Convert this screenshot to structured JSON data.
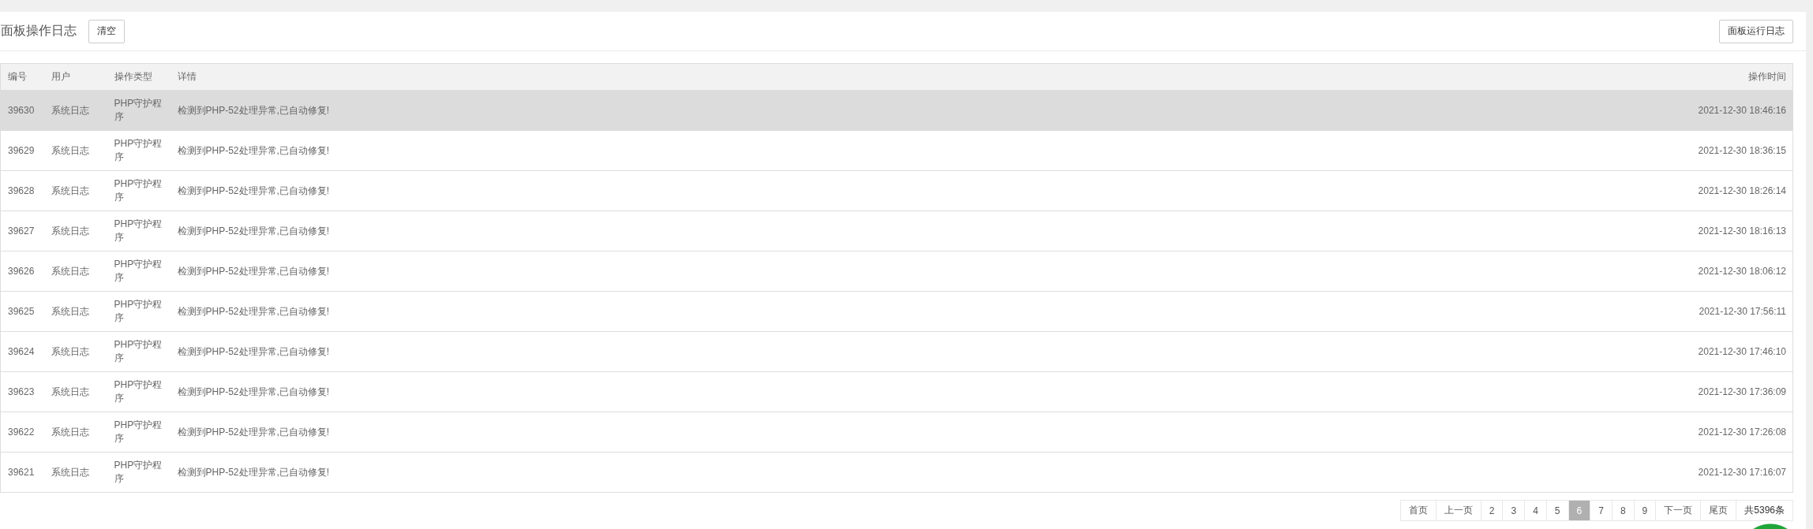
{
  "header": {
    "title": "面板操作日志",
    "clear_button": "清空",
    "run_log_button": "面板运行日志"
  },
  "table": {
    "columns": [
      "编号",
      "用户",
      "操作类型",
      "详情",
      "操作时间"
    ],
    "rows": [
      {
        "id": "39630",
        "user": "系统日志",
        "type": "PHP守护程序",
        "detail": "检测到PHP-52处理异常,已自动修复!",
        "time": "2021-12-30 18:46:16",
        "highlighted": true
      },
      {
        "id": "39629",
        "user": "系统日志",
        "type": "PHP守护程序",
        "detail": "检测到PHP-52处理异常,已自动修复!",
        "time": "2021-12-30 18:36:15",
        "highlighted": false
      },
      {
        "id": "39628",
        "user": "系统日志",
        "type": "PHP守护程序",
        "detail": "检测到PHP-52处理异常,已自动修复!",
        "time": "2021-12-30 18:26:14",
        "highlighted": false
      },
      {
        "id": "39627",
        "user": "系统日志",
        "type": "PHP守护程序",
        "detail": "检测到PHP-52处理异常,已自动修复!",
        "time": "2021-12-30 18:16:13",
        "highlighted": false
      },
      {
        "id": "39626",
        "user": "系统日志",
        "type": "PHP守护程序",
        "detail": "检测到PHP-52处理异常,已自动修复!",
        "time": "2021-12-30 18:06:12",
        "highlighted": false
      },
      {
        "id": "39625",
        "user": "系统日志",
        "type": "PHP守护程序",
        "detail": "检测到PHP-52处理异常,已自动修复!",
        "time": "2021-12-30 17:56:11",
        "highlighted": false
      },
      {
        "id": "39624",
        "user": "系统日志",
        "type": "PHP守护程序",
        "detail": "检测到PHP-52处理异常,已自动修复!",
        "time": "2021-12-30 17:46:10",
        "highlighted": false
      },
      {
        "id": "39623",
        "user": "系统日志",
        "type": "PHP守护程序",
        "detail": "检测到PHP-52处理异常,已自动修复!",
        "time": "2021-12-30 17:36:09",
        "highlighted": false
      },
      {
        "id": "39622",
        "user": "系统日志",
        "type": "PHP守护程序",
        "detail": "检测到PHP-52处理异常,已自动修复!",
        "time": "2021-12-30 17:26:08",
        "highlighted": false
      },
      {
        "id": "39621",
        "user": "系统日志",
        "type": "PHP守护程序",
        "detail": "检测到PHP-52处理异常,已自动修复!",
        "time": "2021-12-30 17:16:07",
        "highlighted": false
      }
    ]
  },
  "pagination": {
    "pages": [
      {
        "label": "首页",
        "selected": false
      },
      {
        "label": "上一页",
        "selected": false
      },
      {
        "label": "2",
        "selected": false
      },
      {
        "label": "3",
        "selected": false
      },
      {
        "label": "4",
        "selected": false
      },
      {
        "label": "5",
        "selected": false
      },
      {
        "label": "6",
        "selected": true
      },
      {
        "label": "7",
        "selected": false
      },
      {
        "label": "8",
        "selected": false
      },
      {
        "label": "9",
        "selected": false
      },
      {
        "label": "下一页",
        "selected": false
      },
      {
        "label": "尾页",
        "selected": false
      }
    ],
    "total": "共5396条"
  }
}
